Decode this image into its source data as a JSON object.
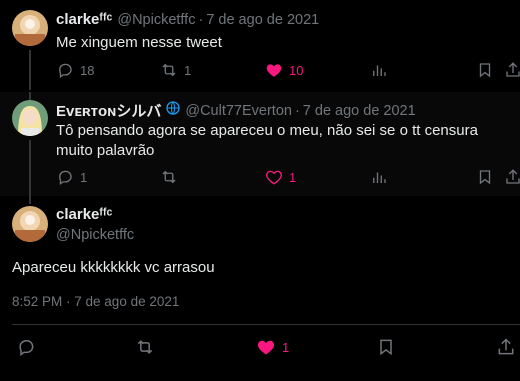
{
  "tweet1": {
    "name": "clarkeᶠᶠᶜ",
    "handle": "@Npicketffc",
    "date": "7 de ago de 2021",
    "text": "Me xinguem nesse tweet",
    "replies": "18",
    "retweets": "1",
    "likes": "10",
    "liked": true
  },
  "tweet2": {
    "name": "Evᴇʀᴛᴏɴシルバ",
    "handle": "@Cult77Everton",
    "date": "7 de ago de 2021",
    "text": "Tô pensando agora se apareceu o meu, não sei se o tt censura muito palavrão",
    "replies": "1",
    "retweets": "",
    "likes": "1"
  },
  "main": {
    "name": "clarkeᶠᶠᶜ",
    "handle": "@Npicketffc",
    "text": "Apareceu kkkkkkkk vc arrasou",
    "timestamp": "8:52 PM · 7 de ago de 2021",
    "likes": "1",
    "liked": true
  },
  "separator": "·",
  "colors": {
    "background": "#000000",
    "like_pink": "#f91880",
    "muted": "#71767b",
    "text": "#e7e9ea"
  }
}
